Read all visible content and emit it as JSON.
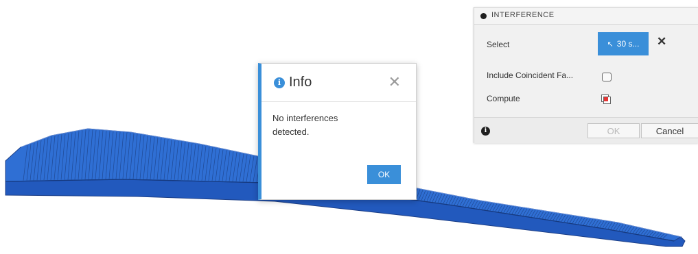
{
  "interference_panel": {
    "title": "INTERFERENCE",
    "select_label": "Select",
    "select_button_text": "30 s...",
    "include_coincident_label": "Include Coincident Fa...",
    "include_coincident_checked": false,
    "compute_label": "Compute",
    "ok_label": "OK",
    "cancel_label": "Cancel"
  },
  "info_dialog": {
    "title": "Info",
    "message": "No interferences detected.",
    "ok_label": "OK"
  },
  "colors": {
    "model_blue": "#2f6fd4",
    "accent_blue": "#3a8fd9",
    "panel_bg": "#f1f1f1"
  },
  "icons": [
    "panel-collapse-dot",
    "cursor-select-icon",
    "clear-selection-icon",
    "checkbox-icon",
    "compute-icon",
    "info-icon",
    "close-icon"
  ]
}
